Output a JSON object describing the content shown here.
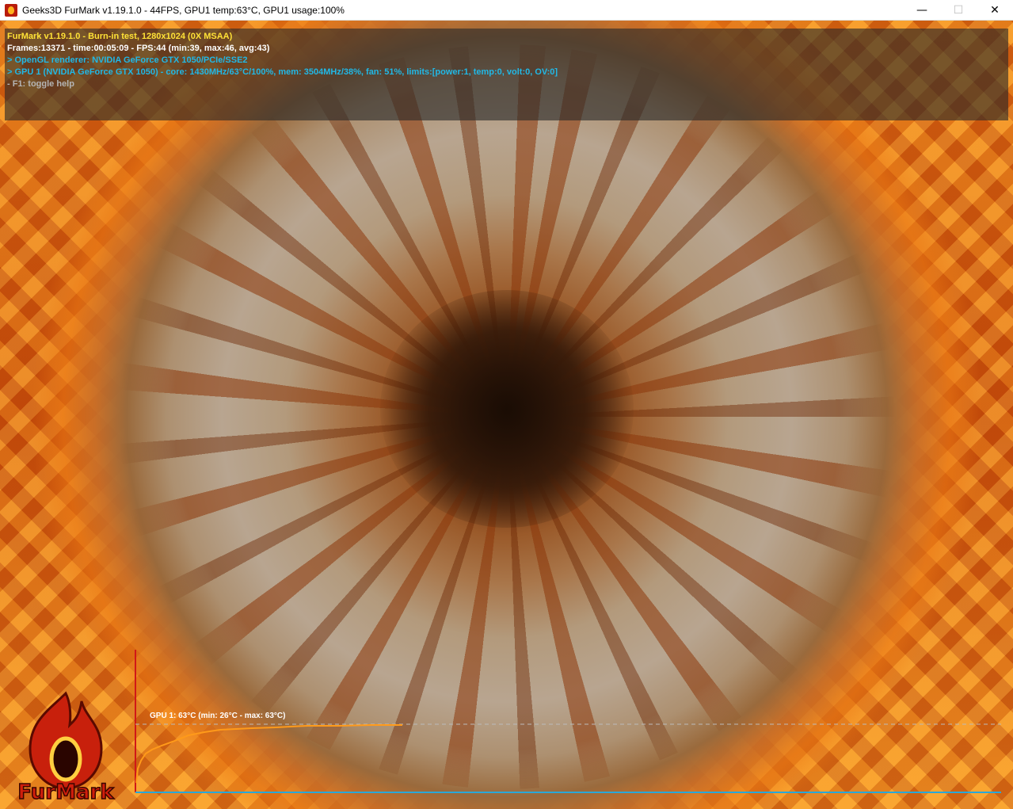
{
  "window": {
    "title": "Geeks3D FurMark v1.19.1.0 - 44FPS, GPU1 temp:63°C, GPU1 usage:100%",
    "icon": "furmark-app-icon",
    "controls": {
      "minimize": "—",
      "maximize": "☐",
      "close": "✕"
    }
  },
  "overlay": {
    "line1": "FurMark v1.19.1.0 - Burn-in test, 1280x1024 (0X MSAA)",
    "line2": "Frames:13371 - time:00:05:09 - FPS:44 (min:39, max:46, avg:43)",
    "line3": "> OpenGL renderer: NVIDIA GeForce GTX 1050/PCIe/SSE2",
    "line4": "> GPU 1 (NVIDIA GeForce GTX 1050) - core: 1430MHz/63°C/100%, mem: 3504MHz/38%, fan: 51%, limits:[power:1, temp:0, volt:0, OV:0]",
    "line5": "- F1: toggle help"
  },
  "logo": {
    "text": "FurMark",
    "icon": "furmark-flame-logo"
  },
  "temperature_graph": {
    "label": "GPU 1: 63°C (min: 26°C - max: 63°C)",
    "current_c": 63,
    "min_c": 26,
    "max_c": 63,
    "colors": {
      "line": "#ff9a1a",
      "axis_x": "#2aa8d8",
      "axis_y": "#d01818",
      "guide": "#bbbbbb"
    }
  },
  "colors": {
    "info_yellow": "#ffe236",
    "info_cyan": "#21b8e6",
    "accent_orange": "#f08a1c"
  }
}
